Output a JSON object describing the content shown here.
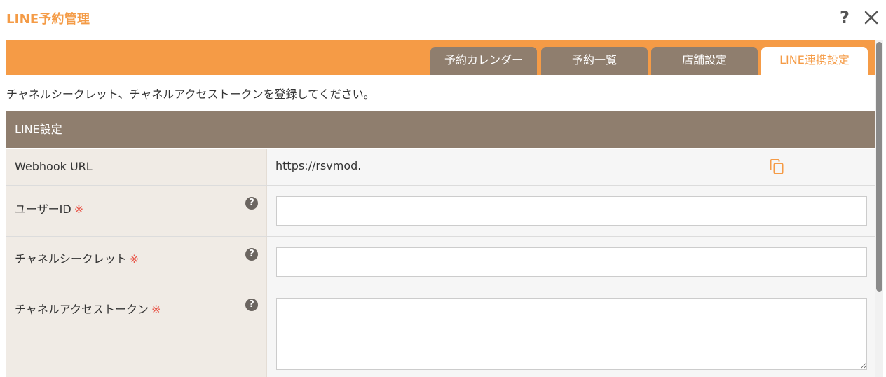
{
  "dialog": {
    "title": "LINE予約管理",
    "help_label": "?"
  },
  "tabs": [
    {
      "label": "予約カレンダー",
      "active": false
    },
    {
      "label": "予約一覧",
      "active": false
    },
    {
      "label": "店舗設定",
      "active": false
    },
    {
      "label": "LINE連携設定",
      "active": true
    }
  ],
  "instruction": "チャネルシークレット、チャネルアクセストークンを登録してください。",
  "section": {
    "title": "LINE設定"
  },
  "fields": {
    "webhook": {
      "label": "Webhook URL",
      "value": "https://rsvmod."
    },
    "user_id": {
      "label": "ユーザーID",
      "required_mark": "※",
      "help": "?",
      "value": "",
      "placeholder": ""
    },
    "channel_secret": {
      "label": "チャネルシークレット",
      "required_mark": "※",
      "help": "?",
      "value": "",
      "placeholder": ""
    },
    "channel_access_token": {
      "label": "チャネルアクセストークン",
      "required_mark": "※",
      "help": "?",
      "value": "",
      "placeholder": ""
    }
  },
  "colors": {
    "accent_orange": "#f59b46",
    "tab_brown": "#8f7e6e",
    "label_bg": "#f0ebe5",
    "required_red": "#e8574a"
  },
  "icons": {
    "help": "question-mark-icon",
    "close": "close-icon",
    "copy": "copy-icon",
    "field_help": "help-circle-icon"
  }
}
